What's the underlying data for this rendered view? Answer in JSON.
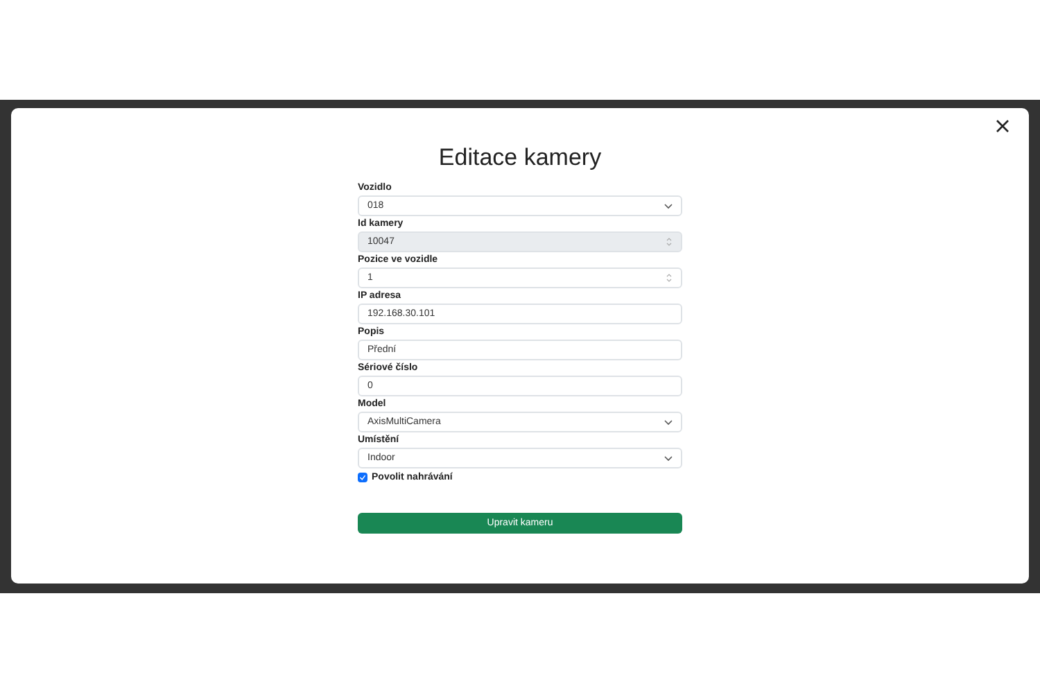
{
  "dialog": {
    "title": "Editace kamery",
    "fields": [
      {
        "label": "Vozidlo",
        "kind": "select",
        "value": "018",
        "disabled": false
      },
      {
        "label": "Id kamery",
        "kind": "number",
        "value": "10047",
        "disabled": true
      },
      {
        "label": "Pozice ve vozidle",
        "kind": "number",
        "value": "1",
        "disabled": false
      },
      {
        "label": "IP adresa",
        "kind": "text",
        "value": "192.168.30.101",
        "disabled": false
      },
      {
        "label": "Popis",
        "kind": "text",
        "value": "Přední",
        "disabled": false
      },
      {
        "label": "Sériové číslo",
        "kind": "text",
        "value": "0",
        "disabled": false
      },
      {
        "label": "Model",
        "kind": "select",
        "value": "AxisMultiCamera",
        "disabled": false
      },
      {
        "label": "Umístění",
        "kind": "select",
        "value": "Indoor",
        "disabled": false
      }
    ],
    "checkbox": {
      "label": "Povolit nahrávání",
      "checked": true
    },
    "submit": "Upravit kameru"
  }
}
